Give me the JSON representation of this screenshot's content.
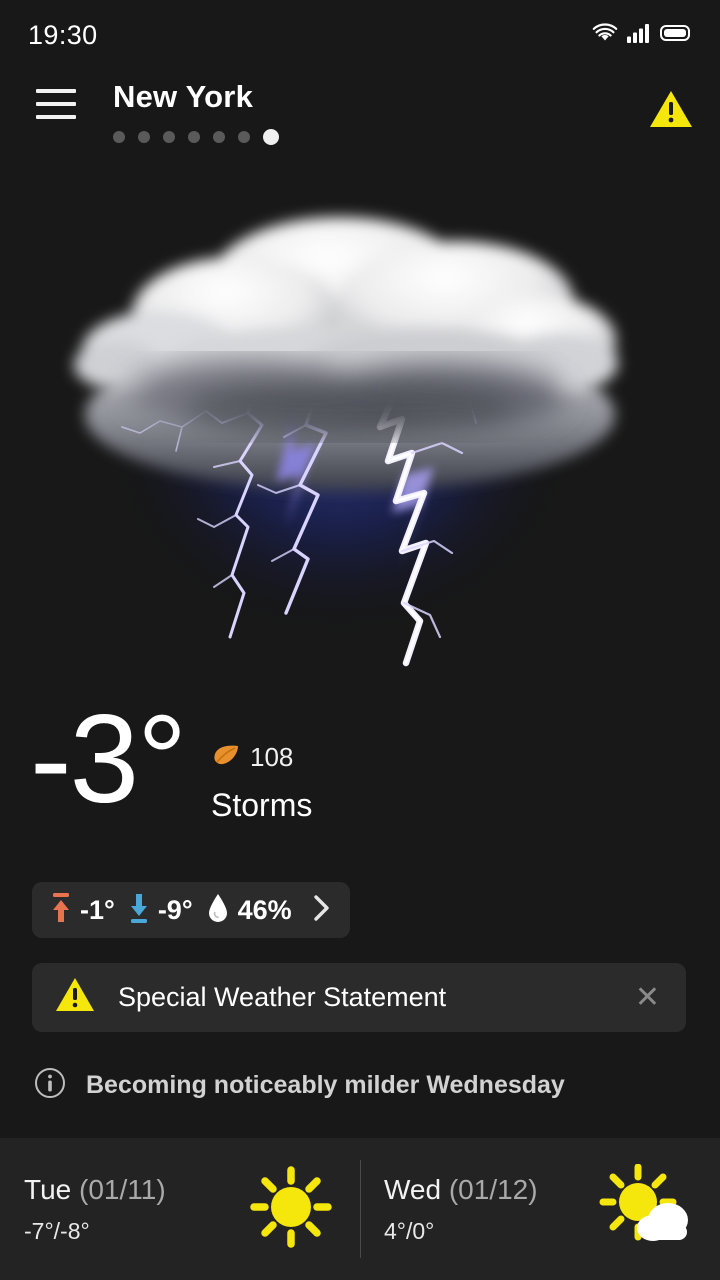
{
  "status_bar": {
    "time": "19:30",
    "icons": [
      "wifi-icon",
      "cellular-signal-icon",
      "battery-icon"
    ]
  },
  "header": {
    "menu_icon": "hamburger-menu-icon",
    "city": "New York",
    "page_dots": {
      "total": 7,
      "active_index": 6
    },
    "alert_icon": "warning-triangle-icon"
  },
  "hero": {
    "icon": "thunderstorm-cloud-lightning-illustration",
    "colors": {
      "cloud": "#e9e9ea",
      "lightning": "#c9c2f5",
      "glow": "#1b2048"
    }
  },
  "current": {
    "temperature": "-3°",
    "aqi_icon": "leaf-icon",
    "aqi_value": "108",
    "condition": "Storms"
  },
  "details": {
    "high_icon": "arrow-up-max-temp-icon",
    "high": "-1°",
    "low_icon": "arrow-down-min-temp-icon",
    "low": "-9°",
    "humidity_icon": "water-droplet-icon",
    "humidity": "46%",
    "chevron_icon": "chevron-right-icon"
  },
  "alert": {
    "icon": "warning-triangle-icon",
    "title": "Special Weather Statement",
    "close_icon": "close-x-icon",
    "close_label": "✕"
  },
  "info": {
    "icon": "info-circle-icon",
    "text": "Becoming noticeably milder Wednesday"
  },
  "forecast": [
    {
      "day": "Tue ",
      "date": "(01/11)",
      "temps": "-7°/-8°",
      "icon": "sunny-icon"
    },
    {
      "day": "Wed ",
      "date": "(01/12)",
      "temps": "4°/0°",
      "icon": "partly-cloudy-icon"
    }
  ],
  "colors": {
    "background": "#181818",
    "card": "#2b2b2b",
    "bottom_bar": "#232323",
    "accent_warning": "#f5e60b",
    "accent_high": "#e8744f",
    "accent_low": "#49a8d8",
    "accent_aqi": "#e8902b",
    "sun": "#f5e60b"
  }
}
